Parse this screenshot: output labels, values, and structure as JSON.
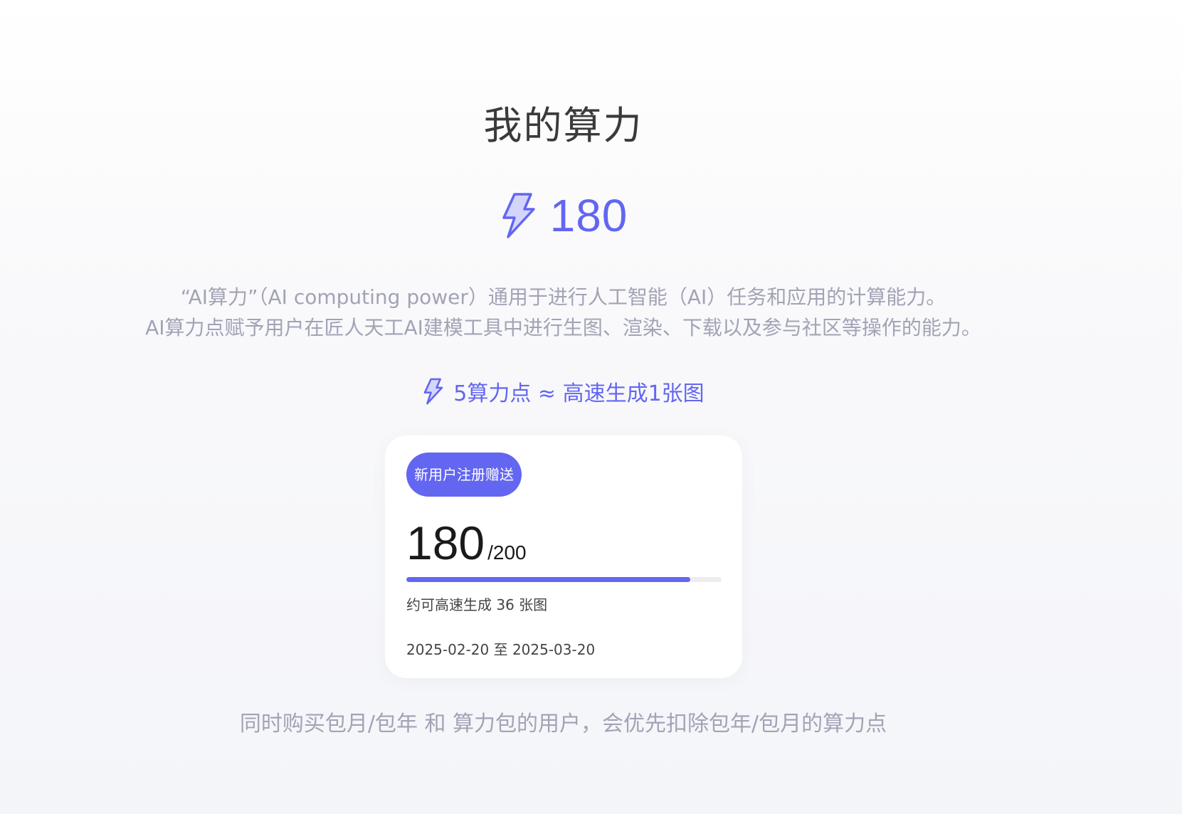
{
  "header": {
    "title": "我的算力"
  },
  "balance": {
    "value": "180",
    "icon": "lightning-bolt-icon"
  },
  "description": {
    "line1": "“AI算力”（AI computing power）通用于进行人工智能（AI）任务和应用的计算能力。",
    "line2": "AI算力点赋予用户在匠人天工AI建模工具中进行生图、渲染、下载以及参与社区等操作的能力。"
  },
  "rate": {
    "icon": "lightning-bolt-icon",
    "text": "5算力点 ≈ 高速生成1张图"
  },
  "card": {
    "badge": "新用户注册赠送",
    "current": "180",
    "separator": "/",
    "total": "200",
    "progress_fraction": 0.9,
    "estimate_prefix": "约可高速生成 ",
    "estimate_count": "36",
    "estimate_suffix": " 张图",
    "period": "2025-02-20 至 2025-03-20"
  },
  "footnote": "同时购买包月/包年 和 算力包的用户，会优先扣除包年/包月的算力点",
  "colors": {
    "accent": "#6366f1",
    "muted_text": "#a2a3b5"
  }
}
